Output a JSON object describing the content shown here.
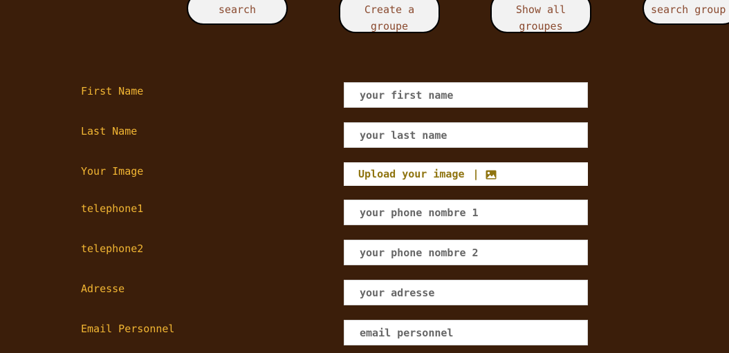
{
  "nav": {
    "search_label": "search",
    "create_group_label": "Create a groupe",
    "show_groups_label": "Show all groupes",
    "search_group_label": "search group"
  },
  "form": {
    "first_name": {
      "label": "First Name",
      "placeholder": "your first name"
    },
    "last_name": {
      "label": "Last Name",
      "placeholder": "your last name"
    },
    "image": {
      "label": "Your Image",
      "upload_text": "Upload your image",
      "separator": "|",
      "icon": "image-icon"
    },
    "telephone1": {
      "label": "telephone1",
      "placeholder": "your phone nombre 1"
    },
    "telephone2": {
      "label": "telephone2",
      "placeholder": "your phone nombre 2"
    },
    "adresse": {
      "label": "Adresse",
      "placeholder": "your adresse"
    },
    "email": {
      "label": "Email Personnel",
      "placeholder": "email personnel"
    }
  },
  "colors": {
    "background": "#3b1e0a",
    "label": "#f2b633",
    "button_bg": "#f2f2f2",
    "button_text": "#8a4a2f",
    "upload_text": "#8f7410"
  }
}
